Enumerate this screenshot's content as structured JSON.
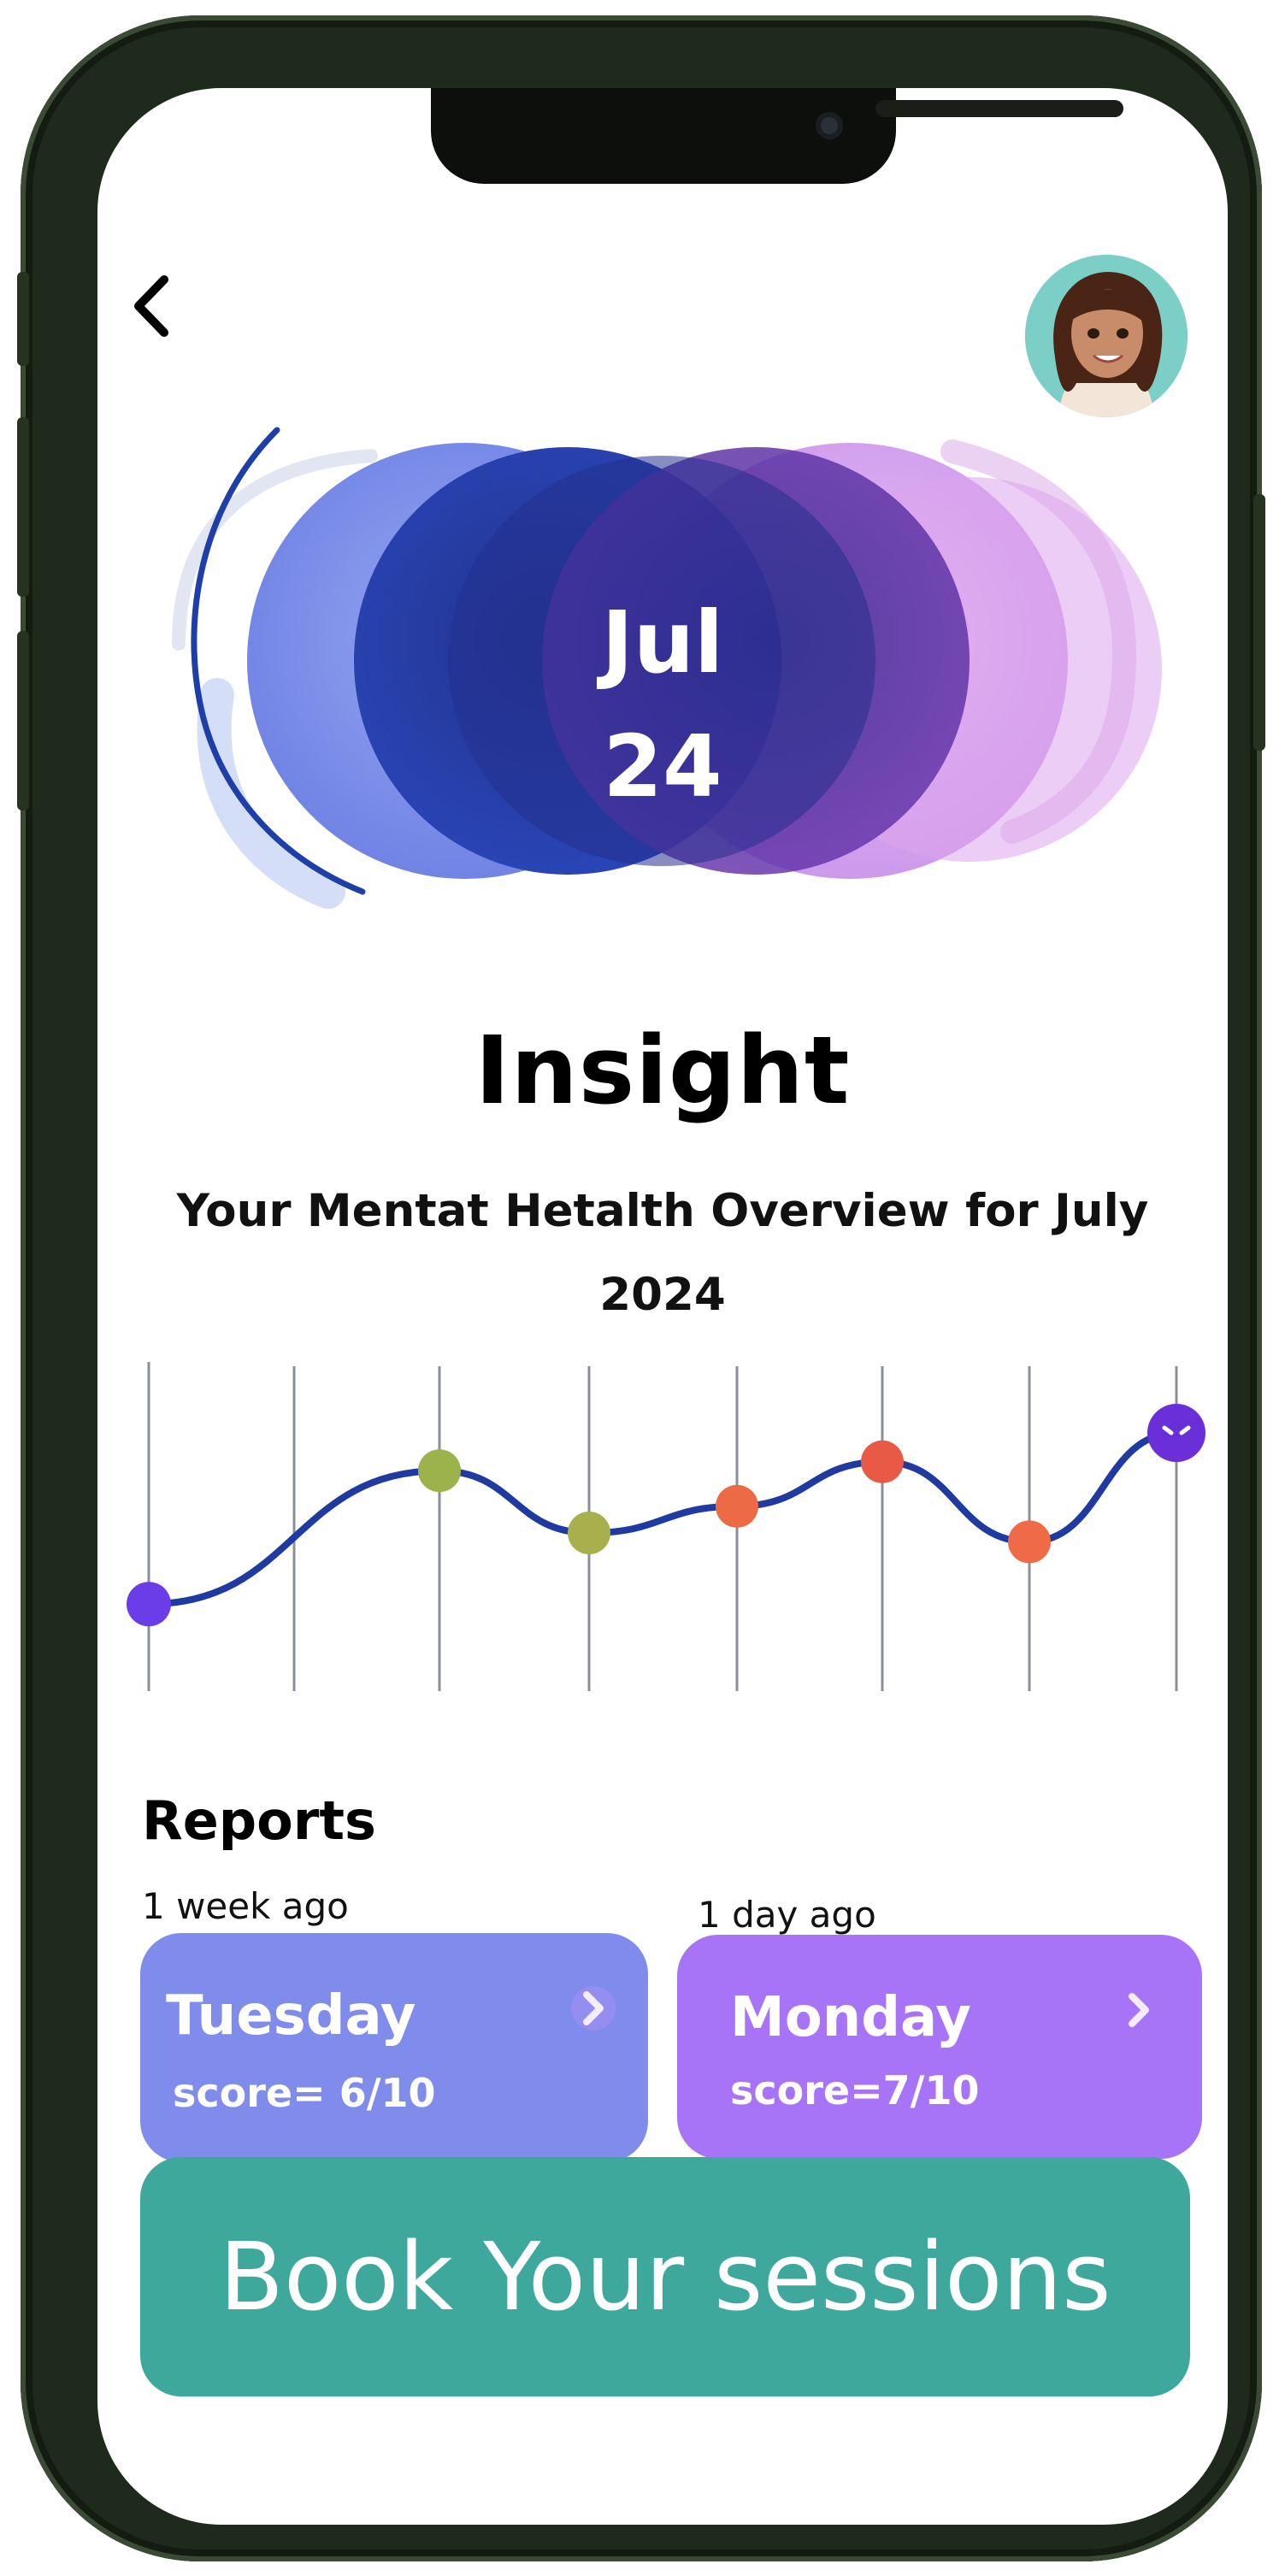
{
  "colors": {
    "accent_blue": "#1f3aa0",
    "accent_purple": "#6b2fa0",
    "tuesday_card": "#7f8cec",
    "monday_card": "#a874f7",
    "book_button": "#3fa89d"
  },
  "header": {
    "back_icon": "chevron-left-icon",
    "avatar_icon": "user-avatar"
  },
  "date_orb": {
    "month": "Jul",
    "day": "24"
  },
  "title": "Insight",
  "subtitle": "Your Mentat Hetalth Overview for July 2024",
  "mood_chart": {
    "levels": [
      0.18,
      0.78,
      0.5,
      0.62,
      0.82,
      0.46,
      0.95
    ],
    "point_colors": [
      "#6a3de8",
      "#9cb24a",
      "#a8b04e",
      "#ec6b45",
      "#e85a45",
      "#ef6b47",
      "#6a2fd8"
    ],
    "end_icon": "mood-face-icon"
  },
  "reports": {
    "heading": "Reports",
    "items": [
      {
        "ago": "1 week ago",
        "day": "Tuesday",
        "score": "score= 6/10"
      },
      {
        "ago": "1 day ago",
        "day": "Monday",
        "score": "score=7/10"
      }
    ]
  },
  "book_button": {
    "label": "Book Your sessions"
  }
}
